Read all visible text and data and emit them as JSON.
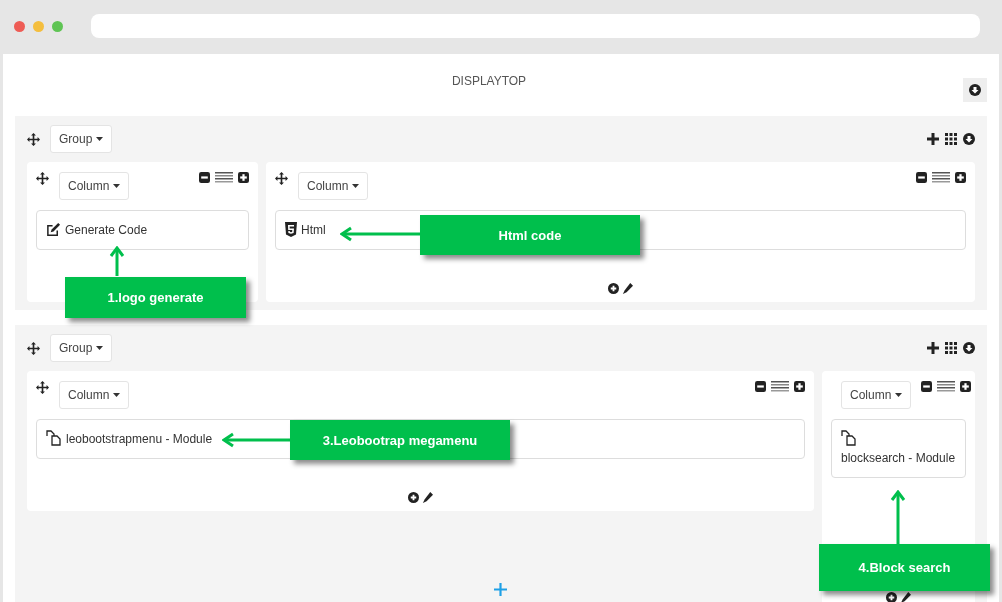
{
  "page": {
    "title": "DISPLAYTOP"
  },
  "groups": [
    {
      "label": "Group",
      "columns": [
        {
          "label": "Column",
          "modules": [
            {
              "kind": "edit",
              "name": "Generate Code"
            }
          ]
        },
        {
          "label": "Column",
          "modules": [
            {
              "kind": "html",
              "name": "Html"
            }
          ]
        }
      ]
    },
    {
      "label": "Group",
      "columns": [
        {
          "label": "Column",
          "modules": [
            {
              "kind": "module",
              "name": "leobootstrapmenu - Module"
            }
          ]
        },
        {
          "label": "Column",
          "modules": [
            {
              "kind": "module",
              "name": "blocksearch - Module"
            }
          ]
        }
      ]
    }
  ],
  "callouts": [
    {
      "text": "1.logo generate"
    },
    {
      "text": "Html code"
    },
    {
      "text": "3.Leobootrap megamenu"
    },
    {
      "text": "4.Block search"
    }
  ]
}
